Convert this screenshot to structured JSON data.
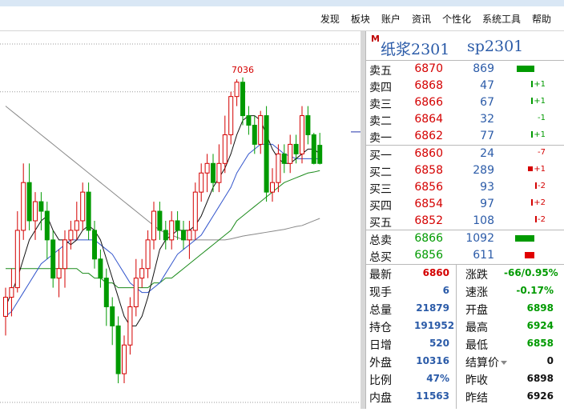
{
  "menu": [
    "发现",
    "板块",
    "账户",
    "资讯",
    "个性化",
    "系统工具",
    "帮助"
  ],
  "instrument": {
    "marker": "M",
    "name": "纸浆2301",
    "code": "sp2301"
  },
  "asks": [
    {
      "label": "卖五",
      "price": "6870",
      "volume": "869",
      "change": ""
    },
    {
      "label": "卖四",
      "price": "6868",
      "volume": "47",
      "change": "+1"
    },
    {
      "label": "卖三",
      "price": "6866",
      "volume": "67",
      "change": "+1"
    },
    {
      "label": "卖二",
      "price": "6864",
      "volume": "32",
      "change": "-1"
    },
    {
      "label": "卖一",
      "price": "6862",
      "volume": "77",
      "change": "+1"
    }
  ],
  "bids": [
    {
      "label": "买一",
      "price": "6860",
      "volume": "24",
      "change": "-7"
    },
    {
      "label": "买二",
      "price": "6858",
      "volume": "289",
      "change": "+1"
    },
    {
      "label": "买三",
      "price": "6856",
      "volume": "93",
      "change": "-2"
    },
    {
      "label": "买四",
      "price": "6854",
      "volume": "97",
      "change": "+2"
    },
    {
      "label": "买五",
      "price": "6852",
      "volume": "108",
      "change": "-2"
    }
  ],
  "totals": [
    {
      "label": "总卖",
      "price": "6866",
      "volume": "1092"
    },
    {
      "label": "总买",
      "price": "6856",
      "volume": "611"
    }
  ],
  "stats": [
    {
      "l1": "最新",
      "v1": "6860",
      "c1": "red",
      "l2": "涨跌",
      "v2": "-66/0.95%",
      "c2": "green"
    },
    {
      "l1": "现手",
      "v1": "6",
      "c1": "blue",
      "l2": "速涨",
      "v2": "-0.17%",
      "c2": "green"
    },
    {
      "l1": "总量",
      "v1": "21879",
      "c1": "blue",
      "l2": "开盘",
      "v2": "6898",
      "c2": "green"
    },
    {
      "l1": "持仓",
      "v1": "191952",
      "c1": "blue",
      "l2": "最高",
      "v2": "6924",
      "c2": "green"
    },
    {
      "l1": "日增",
      "v1": "520",
      "c1": "blue",
      "l2": "最低",
      "v2": "6858",
      "c2": "green"
    },
    {
      "l1": "外盘",
      "v1": "10316",
      "c1": "blue",
      "l2": "结算价",
      "v2": "0",
      "c2": "black"
    },
    {
      "l1": "比例",
      "v1": "47%",
      "c1": "blue",
      "l2": "昨收",
      "v2": "6898",
      "c2": "black"
    },
    {
      "l1": "内盘",
      "v1": "11563",
      "c1": "blue",
      "l2": "昨结",
      "v2": "6926",
      "c2": "black"
    }
  ],
  "chart_data": {
    "type": "candlestick",
    "annotations": [
      "7036"
    ],
    "colors": {
      "up": "#d40000",
      "down": "#009a00",
      "ma5": "#111111",
      "ma10": "#3355cc",
      "ma20": "#1a8a1a",
      "ma60": "#888888",
      "ref": "#2233aa"
    },
    "candles": [
      [
        6540,
        6580,
        6500,
        6600
      ],
      [
        6580,
        6600,
        6540,
        6640
      ],
      [
        6600,
        6720,
        6590,
        6760
      ],
      [
        6720,
        6820,
        6700,
        6860
      ],
      [
        6820,
        6740,
        6720,
        6860
      ],
      [
        6740,
        6780,
        6700,
        6800
      ],
      [
        6780,
        6760,
        6720,
        6800
      ],
      [
        6760,
        6700,
        6660,
        6780
      ],
      [
        6700,
        6620,
        6600,
        6720
      ],
      [
        6620,
        6640,
        6580,
        6680
      ],
      [
        6640,
        6700,
        6600,
        6720
      ],
      [
        6700,
        6720,
        6680,
        6740
      ],
      [
        6720,
        6740,
        6700,
        6780
      ],
      [
        6740,
        6800,
        6720,
        6820
      ],
      [
        6800,
        6720,
        6700,
        6820
      ],
      [
        6720,
        6660,
        6640,
        6740
      ],
      [
        6660,
        6620,
        6600,
        6680
      ],
      [
        6620,
        6560,
        6520,
        6640
      ],
      [
        6560,
        6520,
        6480,
        6580
      ],
      [
        6520,
        6420,
        6400,
        6540
      ],
      [
        6420,
        6480,
        6400,
        6500
      ],
      [
        6480,
        6560,
        6460,
        6580
      ],
      [
        6560,
        6620,
        6540,
        6660
      ],
      [
        6620,
        6640,
        6600,
        6660
      ],
      [
        6640,
        6700,
        6620,
        6720
      ],
      [
        6700,
        6760,
        6680,
        6780
      ],
      [
        6760,
        6720,
        6700,
        6780
      ],
      [
        6720,
        6700,
        6680,
        6740
      ],
      [
        6700,
        6740,
        6680,
        6760
      ],
      [
        6740,
        6720,
        6700,
        6760
      ],
      [
        6720,
        6700,
        6680,
        6740
      ],
      [
        6700,
        6720,
        6660,
        6740
      ],
      [
        6720,
        6800,
        6700,
        6820
      ],
      [
        6800,
        6840,
        6780,
        6860
      ],
      [
        6840,
        6860,
        6800,
        6880
      ],
      [
        6860,
        6820,
        6800,
        6880
      ],
      [
        6820,
        6860,
        6800,
        6900
      ],
      [
        6860,
        6920,
        6840,
        6960
      ],
      [
        6920,
        7000,
        6900,
        7010
      ],
      [
        7000,
        7030,
        6980,
        7036
      ],
      [
        7030,
        6960,
        6940,
        7040
      ],
      [
        6960,
        6940,
        6920,
        6980
      ],
      [
        6940,
        6900,
        6880,
        6960
      ],
      [
        6900,
        6960,
        6880,
        6970
      ],
      [
        6960,
        6800,
        6780,
        6980
      ],
      [
        6800,
        6820,
        6780,
        6850
      ],
      [
        6820,
        6880,
        6800,
        6900
      ],
      [
        6880,
        6860,
        6840,
        6900
      ],
      [
        6860,
        6900,
        6840,
        6920
      ],
      [
        6900,
        6880,
        6860,
        6920
      ],
      [
        6880,
        6960,
        6860,
        6980
      ],
      [
        6960,
        6920,
        6900,
        6980
      ],
      [
        6920,
        6860,
        6858,
        6924
      ],
      [
        6898,
        6860,
        6858,
        6924
      ]
    ],
    "ma_series": {
      "ma5": [
        6560,
        6590,
        6620,
        6660,
        6700,
        6720,
        6740,
        6750,
        6720,
        6700,
        6700,
        6690,
        6700,
        6720,
        6730,
        6720,
        6700,
        6660,
        6620,
        6580,
        6540,
        6520,
        6520,
        6540,
        6580,
        6630,
        6680,
        6700,
        6710,
        6720,
        6720,
        6720,
        6730,
        6750,
        6780,
        6810,
        6830,
        6850,
        6880,
        6920,
        6950,
        6960,
        6960,
        6950,
        6920,
        6890,
        6870,
        6860,
        6860,
        6870,
        6880,
        6890,
        6890,
        6880
      ],
      "ma10": [
        6540,
        6550,
        6570,
        6590,
        6610,
        6630,
        6650,
        6660,
        6670,
        6680,
        6690,
        6700,
        6700,
        6700,
        6700,
        6700,
        6690,
        6680,
        6670,
        6650,
        6630,
        6610,
        6600,
        6590,
        6590,
        6600,
        6610,
        6630,
        6650,
        6670,
        6680,
        6690,
        6700,
        6710,
        6730,
        6750,
        6770,
        6790,
        6810,
        6840,
        6860,
        6880,
        6890,
        6900,
        6900,
        6900,
        6890,
        6880,
        6875,
        6870,
        6870,
        6870,
        6870,
        6870
      ],
      "ma20": [
        6640,
        6640,
        6640,
        6640,
        6640,
        6640,
        6640,
        6640,
        6640,
        6640,
        6640,
        6640,
        6640,
        6630,
        6630,
        6620,
        6620,
        6610,
        6610,
        6600,
        6600,
        6600,
        6600,
        6600,
        6600,
        6610,
        6610,
        6620,
        6620,
        6630,
        6640,
        6650,
        6660,
        6670,
        6680,
        6690,
        6700,
        6710,
        6720,
        6740,
        6750,
        6760,
        6770,
        6780,
        6790,
        6800,
        6810,
        6820,
        6825,
        6830,
        6835,
        6840,
        6842,
        6845
      ],
      "ma60": [
        6980,
        6970,
        6960,
        6950,
        6940,
        6930,
        6920,
        6910,
        6900,
        6890,
        6880,
        6870,
        6860,
        6850,
        6840,
        6830,
        6820,
        6810,
        6800,
        6790,
        6780,
        6770,
        6760,
        6750,
        6740,
        6730,
        6720,
        6715,
        6710,
        6705,
        6700,
        6700,
        6700,
        6700,
        6700,
        6700,
        6700,
        6700,
        6702,
        6705,
        6708,
        6710,
        6712,
        6714,
        6716,
        6718,
        6720,
        6722,
        6725,
        6728,
        6730,
        6735,
        6740,
        6745
      ]
    },
    "ylim": [
      6380,
      7120
    ],
    "ref_price": 7010,
    "current_price": 6926
  }
}
